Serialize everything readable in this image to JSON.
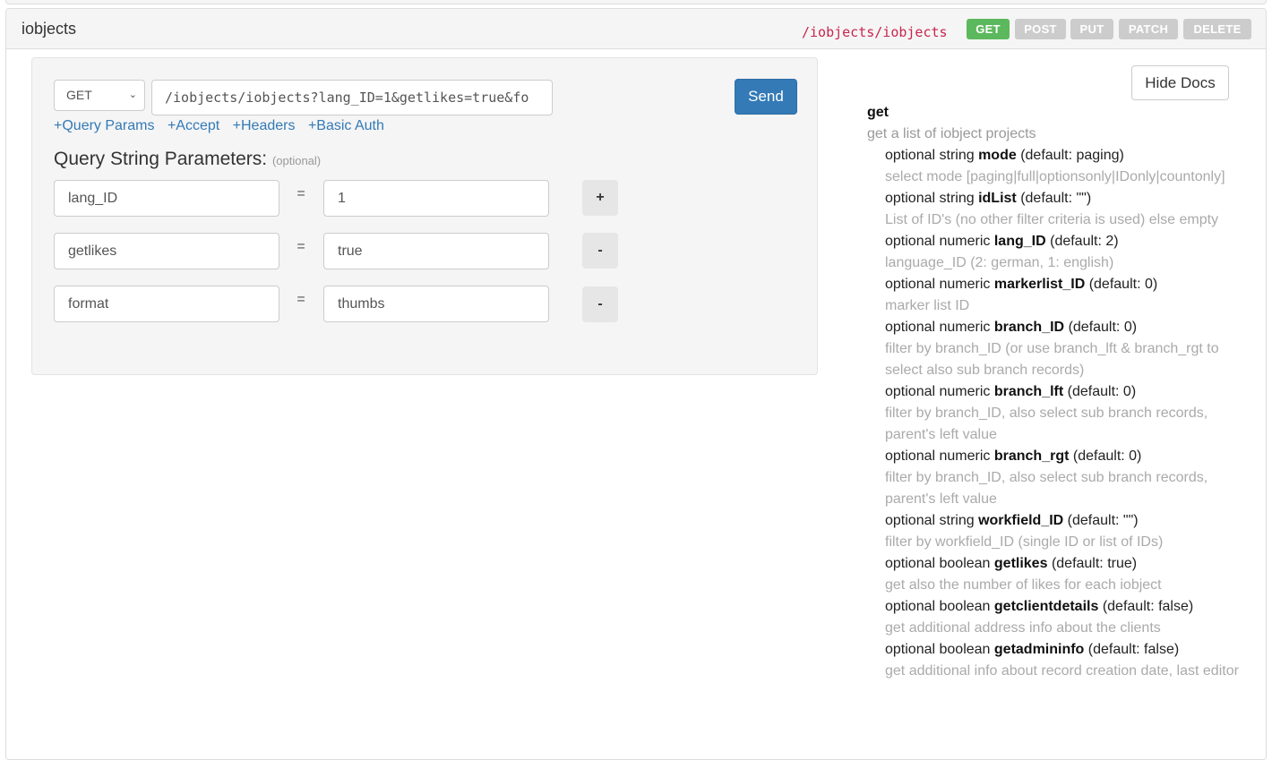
{
  "header": {
    "title": "iobjects",
    "route_path": "/iobjects/iobjects",
    "methods": [
      {
        "label": "GET",
        "active": true
      },
      {
        "label": "POST",
        "active": false
      },
      {
        "label": "PUT",
        "active": false
      },
      {
        "label": "PATCH",
        "active": false
      },
      {
        "label": "DELETE",
        "active": false
      }
    ]
  },
  "request": {
    "method": "GET",
    "url": "/iobjects/iobjects?lang_ID=1&getlikes=true&fo",
    "send_label": "Send",
    "links": [
      "+Query Params",
      "+Accept",
      "+Headers",
      "+Basic Auth"
    ],
    "qs_title": "Query String Parameters:",
    "qs_optional": "(optional)",
    "params": [
      {
        "key": "lang_ID",
        "value": "1",
        "action": "+"
      },
      {
        "key": "getlikes",
        "value": "true",
        "action": "-"
      },
      {
        "key": "format",
        "value": "thumbs",
        "action": "-"
      }
    ],
    "eq": "="
  },
  "docs": {
    "hide_label": "Hide Docs",
    "op_name": "get",
    "op_desc": "get a list of iobject projects",
    "params": [
      {
        "prefix": "optional string",
        "name": "mode",
        "default": "(default: paging)",
        "desc": "select mode [paging|full|optionsonly|IDonly|countonly]"
      },
      {
        "prefix": "optional string",
        "name": "idList",
        "default": "(default: \"\")",
        "desc": "List of ID's (no other filter criteria is used) else empty"
      },
      {
        "prefix": "optional numeric",
        "name": "lang_ID",
        "default": "(default: 2)",
        "desc": "language_ID (2: german, 1: english)"
      },
      {
        "prefix": "optional numeric",
        "name": "markerlist_ID",
        "default": "(default: 0)",
        "desc": "marker list ID"
      },
      {
        "prefix": "optional numeric",
        "name": "branch_ID",
        "default": "(default: 0)",
        "desc": "filter by branch_ID (or use branch_lft & branch_rgt to select also sub branch records)"
      },
      {
        "prefix": "optional numeric",
        "name": "branch_lft",
        "default": "(default: 0)",
        "desc": "filter by branch_ID, also select sub branch records, parent's left value"
      },
      {
        "prefix": "optional numeric",
        "name": "branch_rgt",
        "default": "(default: 0)",
        "desc": "filter by branch_ID, also select sub branch records, parent's left value"
      },
      {
        "prefix": "optional string",
        "name": "workfield_ID",
        "default": "(default: \"\")",
        "desc": "filter by workfield_ID (single ID or list of IDs)"
      },
      {
        "prefix": "optional boolean",
        "name": "getlikes",
        "default": "(default: true)",
        "desc": "get also the number of likes for each iobject"
      },
      {
        "prefix": "optional boolean",
        "name": "getclientdetails",
        "default": "(default: false)",
        "desc": "get additional address info about the clients"
      },
      {
        "prefix": "optional boolean",
        "name": "getadmininfo",
        "default": "(default: false)",
        "desc": "get additional info about record creation date, last editor"
      }
    ]
  }
}
